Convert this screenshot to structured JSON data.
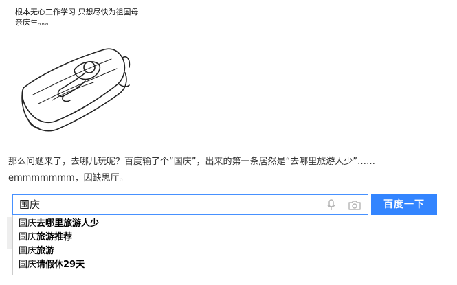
{
  "meme": {
    "caption": "根本无心工作学习 只想尽快为祖国母亲庆生。。。"
  },
  "article": {
    "line1": "那么问题来了，去哪儿玩呢？百度输了个“国庆”，出来的第一条居然是“去哪里旅游人少”……",
    "line2": "emmmmmmm，因缺思厅。"
  },
  "search": {
    "query": "国庆",
    "button_label": "百度一下",
    "mic_icon": "microphone-icon",
    "camera_icon": "camera-icon",
    "accent_color": "#3385ff",
    "suggestions": [
      {
        "prefix": "国庆",
        "rest": "去哪里旅游人少"
      },
      {
        "prefix": "国庆",
        "rest": "旅游推荐"
      },
      {
        "prefix": "国庆",
        "rest": "旅游"
      },
      {
        "prefix": "国庆",
        "rest": "请假休29天"
      }
    ]
  }
}
